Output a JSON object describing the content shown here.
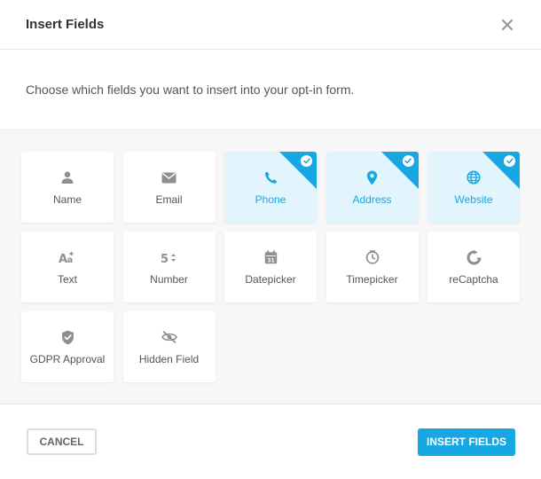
{
  "header": {
    "title": "Insert Fields",
    "close_icon": "close-icon"
  },
  "intro": {
    "text": "Choose which fields you want to insert into your opt-in form."
  },
  "colors": {
    "accent": "#17a8e3",
    "selected_bg": "#e2f5fd",
    "icon_gray": "#8f8f8f"
  },
  "fields": [
    {
      "label": "Name",
      "icon": "user-icon",
      "selected": false
    },
    {
      "label": "Email",
      "icon": "envelope-icon",
      "selected": false
    },
    {
      "label": "Phone",
      "icon": "phone-icon",
      "selected": true
    },
    {
      "label": "Address",
      "icon": "map-pin-icon",
      "selected": true
    },
    {
      "label": "Website",
      "icon": "globe-icon",
      "selected": true
    },
    {
      "label": "Text",
      "icon": "text-format-icon",
      "selected": false
    },
    {
      "label": "Number",
      "icon": "number-icon",
      "selected": false
    },
    {
      "label": "Datepicker",
      "icon": "calendar-icon",
      "selected": false
    },
    {
      "label": "Timepicker",
      "icon": "clock-icon",
      "selected": false
    },
    {
      "label": "reCaptcha",
      "icon": "recaptcha-icon",
      "selected": false
    },
    {
      "label": "GDPR Approval",
      "icon": "shield-check-icon",
      "selected": false
    },
    {
      "label": "Hidden Field",
      "icon": "eye-slash-icon",
      "selected": false
    }
  ],
  "footer": {
    "cancel_label": "CANCEL",
    "insert_label": "INSERT FIELDS"
  }
}
